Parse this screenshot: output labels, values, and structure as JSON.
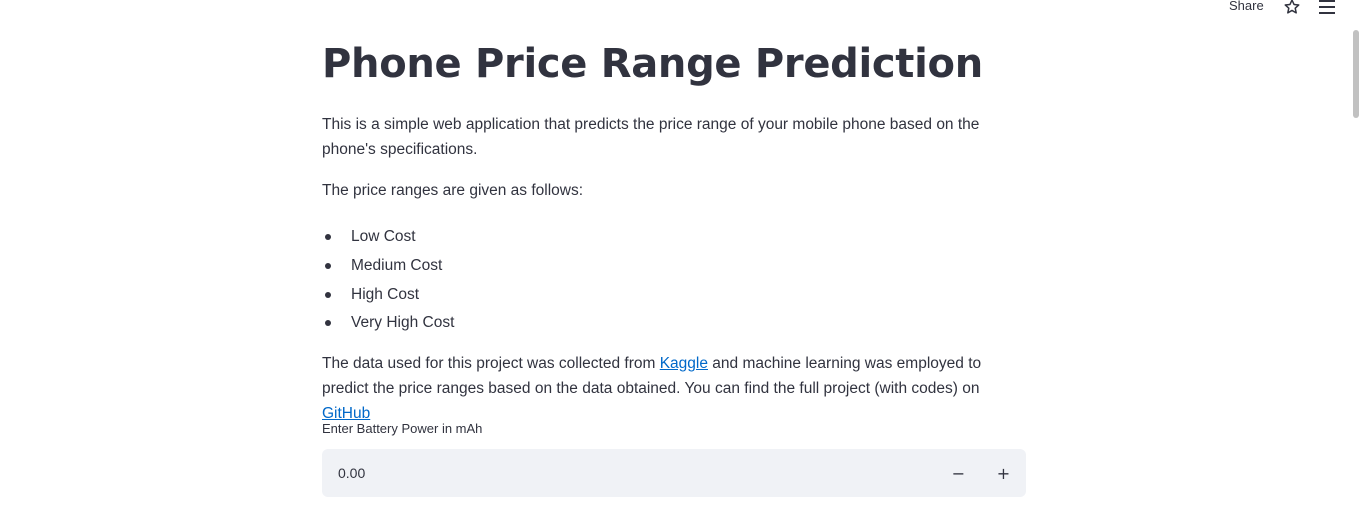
{
  "toolbar": {
    "share_label": "Share",
    "star_icon": "star-icon",
    "menu_icon": "hamburger-menu-icon"
  },
  "main": {
    "title": "Phone Price Range Prediction",
    "intro": "This is a simple web application that predicts the price range of your mobile phone based on the phone's specifications.",
    "ranges_intro": "The price ranges are given as follows:",
    "ranges": [
      "Low Cost",
      "Medium Cost",
      "High Cost",
      "Very High Cost"
    ],
    "data_text_1": "The data used for this project was collected from ",
    "kaggle_link": "Kaggle",
    "data_text_2": " and machine learning was employed to predict the price ranges based on the data obtained. You can find the full project (with codes) on ",
    "github_link": "GitHub"
  },
  "battery_input": {
    "label": "Enter Battery Power in mAh",
    "value": "0.00",
    "decrement": "−",
    "increment": "+"
  },
  "colors": {
    "text": "#31333f",
    "link": "#0068c9",
    "input_bg": "#f0f2f6"
  }
}
